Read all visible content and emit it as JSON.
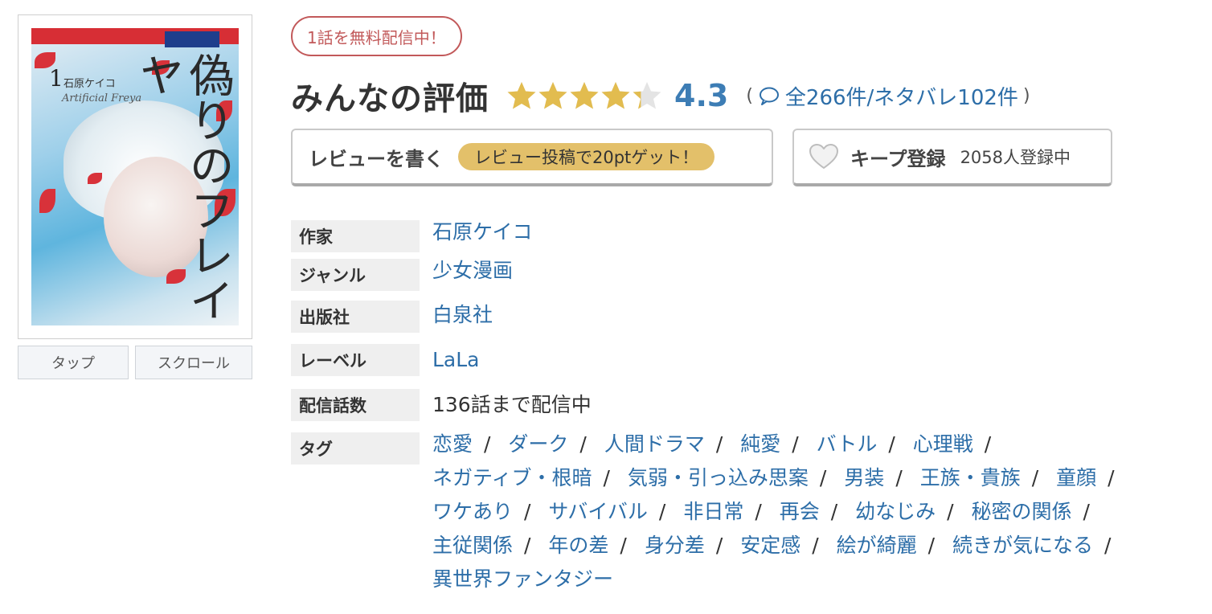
{
  "cover": {
    "title_text": "偽りのフレイヤ",
    "volume": "1",
    "author_small": "石原ケイコ",
    "subtitle_sign": "Artificial Freya"
  },
  "view_tabs": {
    "tap": "タップ",
    "scroll": "スクロール"
  },
  "free_badge": "1話を無料配信中！",
  "rating": {
    "label": "みんなの評価",
    "value": "4.3",
    "stars_value": 4.3,
    "stars_max": 5,
    "open_paren": "(",
    "close_paren": ")",
    "counts": "全266件/ネタバレ102件"
  },
  "review_button": {
    "label": "レビューを書く",
    "points_pill": "レビュー投稿で20ptゲット！"
  },
  "keep_button": {
    "label": "キープ登録",
    "count": "2058人登録中"
  },
  "info": {
    "author_key": "作家",
    "author_val": "石原ケイコ",
    "genre_key": "ジャンル",
    "genre_val": "少女漫画",
    "publisher_key": "出版社",
    "publisher_val": "白泉社",
    "label_key": "レーベル",
    "label_val": "LaLa",
    "episodes_key": "配信話数",
    "episodes_val": "136話まで配信中",
    "tags_key": "タグ"
  },
  "tags": [
    "恋愛",
    "ダーク",
    "人間ドラマ",
    "純愛",
    "バトル",
    "心理戦",
    "ネガティブ・根暗",
    "気弱・引っ込み思案",
    "男装",
    "王族・貴族",
    "童顔",
    "ワケあり",
    "サバイバル",
    "非日常",
    "再会",
    "幼なじみ",
    "秘密の関係",
    "主従関係",
    "年の差",
    "身分差",
    "安定感",
    "絵が綺麗",
    "続きが気になる",
    "異世界ファンタジー"
  ],
  "tag_separator": "/",
  "colors": {
    "link": "#2d6ea8",
    "badge_red": "#c2595a",
    "star_gold": "#e2bc4f",
    "rating_blue": "#3d7db5",
    "pill_gold": "#e3c06a"
  }
}
